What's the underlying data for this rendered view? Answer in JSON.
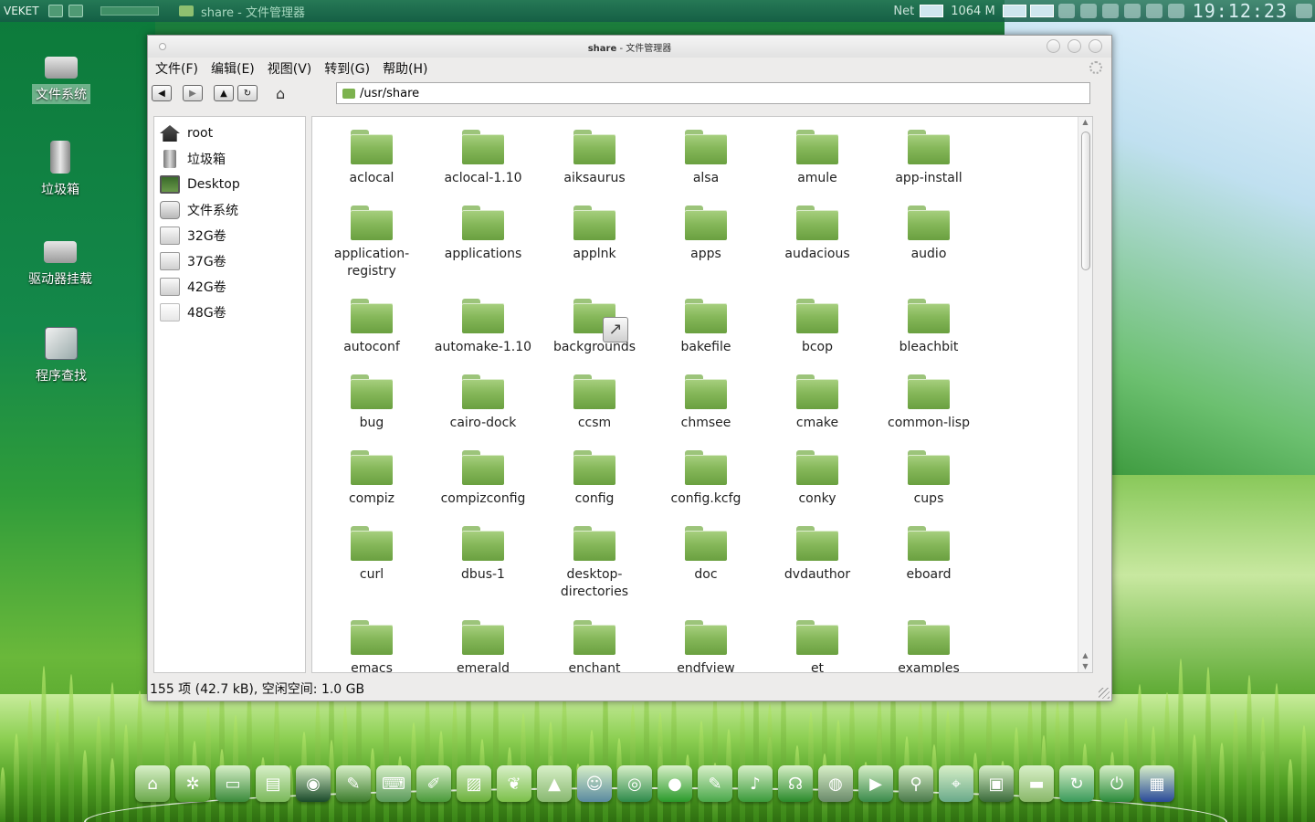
{
  "top_panel": {
    "brand": "VEKET",
    "task_title": "share - 文件管理器",
    "net_label": "Net",
    "memory": "1064 M",
    "clock": "19:12:23"
  },
  "desktop_icons": [
    {
      "label": "文件系统",
      "icon": "hard-drive-icon",
      "selected": true
    },
    {
      "label": "垃圾箱",
      "icon": "trash-icon",
      "selected": false
    },
    {
      "label": "驱动器挂载",
      "icon": "drive-mount-icon",
      "selected": false
    },
    {
      "label": "程序查找",
      "icon": "program-search-icon",
      "selected": false
    }
  ],
  "window": {
    "title_bold": "share",
    "title_rest": " - 文件管理器",
    "menu": [
      "文件(F)",
      "编辑(E)",
      "视图(V)",
      "转到(G)",
      "帮助(H)"
    ],
    "path": "/usr/share",
    "status": "155 项 (42.7 kB), 空闲空间:  1.0 GB"
  },
  "sidebar": [
    {
      "label": "root",
      "icon": "home-icon"
    },
    {
      "label": "垃圾箱",
      "icon": "trash-icon"
    },
    {
      "label": "Desktop",
      "icon": "desktop-icon"
    },
    {
      "label": "文件系统",
      "icon": "filesystem-icon"
    },
    {
      "label": "32G卷",
      "icon": "volume-icon"
    },
    {
      "label": "37G卷",
      "icon": "volume-icon"
    },
    {
      "label": "42G卷",
      "icon": "volume-icon"
    },
    {
      "label": "48G卷",
      "icon": "volume-icon"
    }
  ],
  "files": [
    [
      "aclocal",
      "aclocal-1.10",
      "aiksaurus",
      "alsa",
      "amule",
      "app-install"
    ],
    [
      "application-\nregistry",
      "applications",
      "applnk",
      "apps",
      "audacious",
      "audio"
    ],
    [
      "autoconf",
      "automake-1.10",
      "backgrounds",
      "bakefile",
      "bcop",
      "bleachbit"
    ],
    [
      "bug",
      "cairo-dock",
      "ccsm",
      "chmsee",
      "cmake",
      "common-lisp"
    ],
    [
      "compiz",
      "compizconfig",
      "config",
      "config.kcfg",
      "conky",
      "cups"
    ],
    [
      "curl",
      "dbus-1",
      "desktop-\ndirectories",
      "doc",
      "dvdauthor",
      "eboard"
    ],
    [
      "emacs",
      "emerald",
      "enchant",
      "endfview",
      "et",
      "examples"
    ]
  ],
  "symlinks": [
    "backgrounds"
  ],
  "dock_icons": [
    "home-icon",
    "settings-icon",
    "display-icon",
    "spreadsheet-icon",
    "eye-icon",
    "pen-icon",
    "keyboard-icon",
    "paint-icon",
    "graphics-icon",
    "leaf-icon",
    "pdf-icon",
    "users-icon",
    "browser-icon",
    "green-app-icon",
    "edit-icon",
    "music-note-icon",
    "headphones-icon",
    "disc-icon",
    "play-icon",
    "search-icon",
    "map-search-icon",
    "photo-icon",
    "drive-icon",
    "refresh-icon",
    "power-icon",
    "wallpaper-icon"
  ],
  "colors": {
    "folder": "#86b85a",
    "window_bg": "#edeceb",
    "panel": "#1e6a52"
  }
}
